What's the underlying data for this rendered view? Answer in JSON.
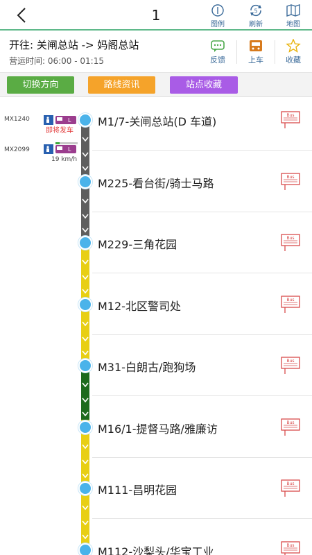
{
  "header": {
    "route_number": "1",
    "actions": [
      {
        "label": "图例",
        "icon": "info-icon"
      },
      {
        "label": "刷新",
        "icon": "refresh-icon",
        "badge": "5"
      },
      {
        "label": "地图",
        "icon": "map-icon"
      }
    ]
  },
  "info": {
    "destination": "开往: 关闸总站 -> 妈阁总站",
    "hours": "营运时间: 06:00 - 01:15",
    "actions": [
      {
        "label": "反馈",
        "icon": "feedback-icon"
      },
      {
        "label": "上车",
        "icon": "bus-icon"
      },
      {
        "label": "收藏",
        "icon": "star-icon"
      }
    ]
  },
  "buttons": [
    {
      "label": "切换方向",
      "color": "#5aac44"
    },
    {
      "label": "路线资讯",
      "color": "#f5a32a"
    },
    {
      "label": "站点收藏",
      "color": "#a95ce6"
    }
  ],
  "stops": [
    {
      "name": "M1/7-关闸总站(D 车道)"
    },
    {
      "name": "M225-看台街/骑士马路"
    },
    {
      "name": "M229-三角花园"
    },
    {
      "name": "M12-北区警司处"
    },
    {
      "name": "M31-白朗古/跑狗场"
    },
    {
      "name": "M16/1-提督马路/雅廉访"
    },
    {
      "name": "M111-昌明花园"
    },
    {
      "name": "M112-沙梨头/华宝工业"
    }
  ],
  "vehicles": [
    {
      "plate": "MX1240",
      "status": "即将发车"
    },
    {
      "plate": "MX2099",
      "speed": "19 km/h"
    }
  ],
  "colors": {
    "accent": "#5fb98a",
    "link": "#3a6a99",
    "stop_dot": "#4ab3ea",
    "traffic_slow": "#5e5e5e",
    "traffic_normal": "#e8cf14",
    "traffic_fast": "#1d6b1d",
    "vehicle": "#9b3d8e"
  },
  "bus_stop_icon_text": "Bus"
}
